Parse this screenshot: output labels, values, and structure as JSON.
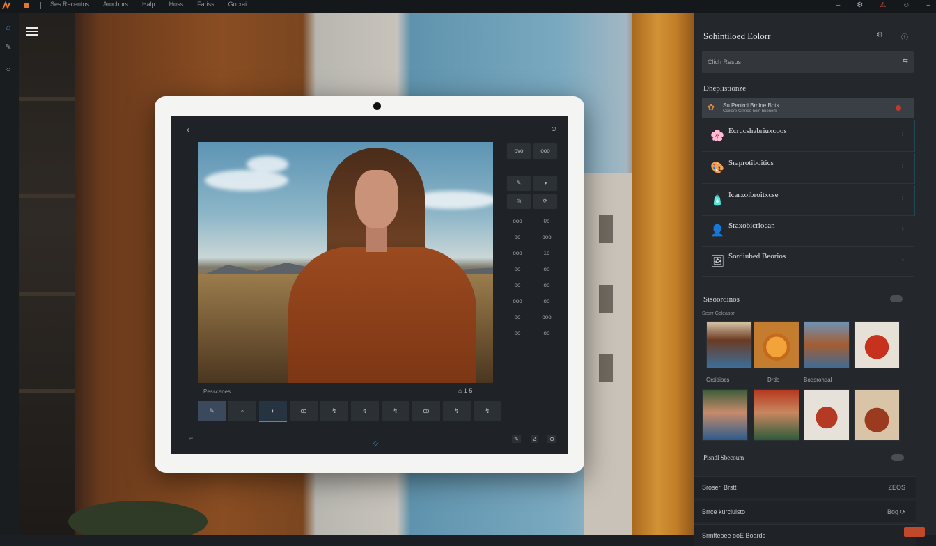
{
  "topbar": {
    "menu": [
      "Ses Recentos",
      "Arochurs",
      "Halp",
      "Hoss",
      "Fariss",
      "Gocrai"
    ],
    "icons": [
      "window-icon",
      "settings-icon",
      "alert-icon",
      "account-icon",
      "close-icon"
    ]
  },
  "editor": {
    "caption": "Pesscenes",
    "caption_icons": "⌂ 1 5 ⋯",
    "back_glyph": "‹",
    "power_glyph": "⊙",
    "side_values": [
      "ovo",
      "ooo",
      "0o",
      "ooo",
      "1o",
      "oo",
      "oo",
      "oo",
      "ooo",
      "oo"
    ],
    "side_left": [
      "ooo",
      "oo",
      "ooo",
      "oo",
      "oo",
      "ooo",
      "oo",
      "oo"
    ],
    "film_glyphs": [
      "✎",
      "∘",
      "◐",
      "ꝏ",
      "↯",
      "↯",
      "↯",
      "ꝏ",
      "↯",
      "↯"
    ],
    "bottom_left": "⌐",
    "bottom_center": "◇",
    "bottom_right": [
      "✎",
      "2",
      "⊙"
    ]
  },
  "panel": {
    "title": "Sohintiloed Eolorr",
    "search_placeholder": "Clich Resus",
    "section1": "Dheplistionze",
    "list_header": {
      "title": "Su Peniroi Brdine Bots",
      "subtitle": "Coiilore Crlinee noin brionerk"
    },
    "items": [
      {
        "label": "Ecrucshabriuxcoos",
        "icon": "🌸"
      },
      {
        "label": "Sraprotiboitics",
        "icon": "🎨"
      },
      {
        "label": "Icarxoibroitxcse",
        "icon": "🧴"
      },
      {
        "label": "Sraxobicriocan",
        "icon": "👤"
      },
      {
        "label": "Sordiubed Beorios",
        "icon": "🖼"
      }
    ],
    "section2": "Sisoordinos",
    "section2_sub": "Sesrr Gcleasor",
    "grid_labels_row1": [
      "Orsidiocs",
      "Drdo",
      "Bodsrohdal"
    ],
    "section3": "Pisndl Sbecoum",
    "bar1": {
      "left": "Sroserl Brstt",
      "right": "ZEOS"
    },
    "bar2": {
      "left": "Brrce kurcluisto",
      "right": "Bog ⟳"
    },
    "bar3": {
      "left": "Srmtteoee ooE Boards"
    }
  },
  "colors": {
    "accent": "#3b8fe0",
    "danger": "#c0392b",
    "brand": "#e07a2f"
  }
}
